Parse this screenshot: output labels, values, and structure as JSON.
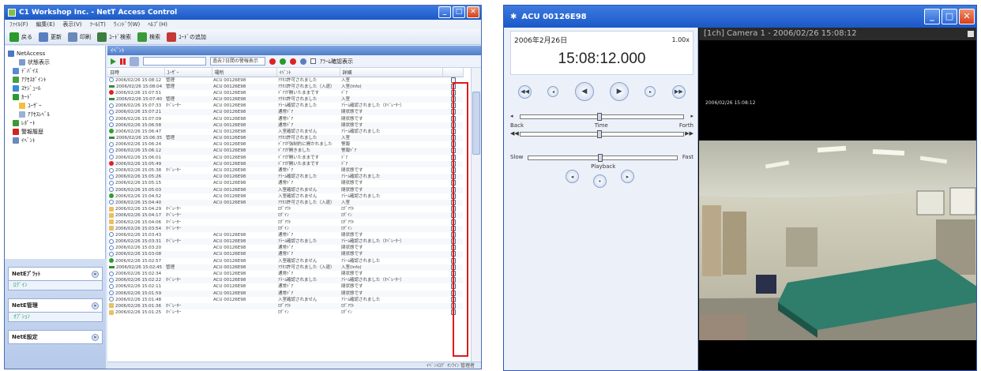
{
  "left_window": {
    "title": "C1 Workshop Inc. - NetT Access Control",
    "menu": [
      "ﾌｧｲﾙ(F)",
      "編集(E)",
      "表示(V)",
      "ﾂｰﾙ(T)",
      "ｳｨﾝﾄﾞｳ(W)",
      "ﾍﾙﾌﾟ(H)"
    ],
    "toolbar": [
      {
        "label": "戻る",
        "color": "#2c9a2c"
      },
      {
        "label": "更新",
        "color": "#5a7fc0"
      },
      {
        "label": "印刷",
        "color": "#6a8ab8"
      },
      {
        "label": "ｺｰﾄﾞ検索",
        "color": "#3f7c3f"
      },
      {
        "label": "検索",
        "color": "#3a9a3a"
      },
      {
        "label": "ｺｰﾄﾞの追加",
        "color": "#c43838"
      }
    ],
    "tree": [
      {
        "label": "NetAccess",
        "color": "#4a78c4"
      },
      {
        "label": "状態表示",
        "color": "#7c9ad0"
      },
      {
        "label": "ﾃﾞﾊﾞｲｽ",
        "color": "#5a8ad4"
      },
      {
        "label": "ｱｸｾｽﾎﾟｲﾝﾄ",
        "color": "#45a045"
      },
      {
        "label": "ｽｹｼﾞｭｰﾙ",
        "color": "#3a8ad4"
      },
      {
        "label": "ｶｰﾄﾞ",
        "color": "#2c9a2c"
      },
      {
        "label": "ﾕｰｻﾞｰ",
        "color": "#f0c040"
      },
      {
        "label": "ｱｸｾｽﾚﾍﾞﾙ",
        "color": "#9ab0d8"
      },
      {
        "label": "ﾚﾎﾟｰﾄ",
        "color": "#3a9a3a"
      },
      {
        "label": "警報履歴",
        "color": "#d22222"
      },
      {
        "label": "ｲﾍﾞﾝﾄ",
        "color": "#6a8ab8"
      }
    ],
    "panels": [
      {
        "title": "NetEﾌﾟﾗｯﾄ",
        "item": "ﾛｸﾞｲﾝ"
      },
      {
        "title": "NetE管理",
        "item": "ｵﾌﾟｼｮﾝ"
      },
      {
        "title": "NetE設定",
        "item": ""
      }
    ],
    "list_header": "ｲﾍﾞﾝﾄ",
    "filter": {
      "dropdown": "過去7日間の警報表示",
      "checkbox_label": "ｱﾗｰﾑ確認表示"
    },
    "columns": [
      "日時",
      "ﾕｰｻﾞｰ",
      "場所",
      "ｲﾍﾞﾝﾄ",
      "詳細",
      ""
    ],
    "rows": [
      [
        "info",
        "2006/02/26 15:08:12",
        "管理",
        "ACU 00126E98",
        "ｱｸｾｽ許可されました",
        "入室"
      ],
      [
        "bar",
        "2006/02/26 15:08:04",
        "管理",
        "ACU 00126E98",
        "ｱｸｾｽ許可されました（入退）",
        "入室(Info)"
      ],
      [
        "red",
        "2006/02/26 15:07:51",
        "",
        "ACU 00126E98",
        "ﾄﾞｱが開いたままです",
        "ﾄﾞｱ"
      ],
      [
        "bar",
        "2006/02/26 15:07:40",
        "管理",
        "ACU 00126E98",
        "ｱｸｾｽ許可されました",
        "入室"
      ],
      [
        "info",
        "2006/02/26 15:07:33",
        "ｵﾍﾟﾚｰﾀｰ",
        "ACU 00126E98",
        "ｱﾗｰﾑ確認されました",
        "ｱﾗｰﾑ確認されました（ｵﾍﾟﾚｰﾀｰ）"
      ],
      [
        "info",
        "2006/02/26 15:07:21",
        "",
        "ACU 00126E98",
        "通常ﾄﾞｱ",
        "閉状態です"
      ],
      [
        "info",
        "2006/02/26 15:07:09",
        "",
        "ACU 00126E98",
        "通常ﾄﾞｱ",
        "閉状態です"
      ],
      [
        "info",
        "2006/02/26 15:06:58",
        "",
        "ACU 00126E98",
        "通常ﾄﾞｱ",
        "閉状態です"
      ],
      [
        "green",
        "2006/02/26 15:06:47",
        "",
        "ACU 00126E98",
        "入室確認されません",
        "ｱﾗｰﾑ確認されました"
      ],
      [
        "bar",
        "2006/02/26 15:06:35",
        "管理",
        "ACU 00126E98",
        "ｱｸｾｽ許可されました",
        "入室"
      ],
      [
        "info",
        "2006/02/26 15:06:24",
        "",
        "ACU 00126E98",
        "ﾄﾞｱが強制的に開かれました",
        "警報"
      ],
      [
        "info",
        "2006/02/26 15:06:12",
        "",
        "ACU 00126E98",
        "ﾄﾞｱが開きました",
        "警報ﾄﾞｱ"
      ],
      [
        "info",
        "2006/02/26 15:06:01",
        "",
        "ACU 00126E98",
        "ﾄﾞｱが開いたままです",
        "ﾄﾞｱ"
      ],
      [
        "red",
        "2006/02/26 15:05:49",
        "",
        "ACU 00126E98",
        "ﾄﾞｱが開いたままです",
        "ﾄﾞｱ"
      ],
      [
        "info",
        "2006/02/26 15:05:38",
        "ｵﾍﾟﾚｰﾀｰ",
        "ACU 00126E98",
        "通常ﾄﾞｱ",
        "閉状態です"
      ],
      [
        "info",
        "2006/02/26 15:05:26",
        "",
        "ACU 00126E98",
        "ｱﾗｰﾑ確認されました",
        "ｱﾗｰﾑ確認されました"
      ],
      [
        "info",
        "2006/02/26 15:05:15",
        "",
        "ACU 00126E98",
        "通常ﾄﾞｱ",
        "閉状態です"
      ],
      [
        "info",
        "2006/02/26 15:05:03",
        "",
        "ACU 00126E98",
        "入室確認されません",
        "閉状態です"
      ],
      [
        "green",
        "2006/02/26 15:04:52",
        "",
        "ACU 00126E98",
        "入室確認されません",
        "ｱﾗｰﾑ確認されました"
      ],
      [
        "info",
        "2006/02/26 15:04:40",
        "",
        "ACU 00126E98",
        "ｱｸｾｽ許可されました（入退）",
        "入室"
      ],
      [
        "doc",
        "2006/02/26 15:04:29",
        "ｵﾍﾟﾚｰﾀｰ",
        "",
        "ﾛｸﾞｱｳﾄ",
        "ﾛｸﾞｱｳﾄ"
      ],
      [
        "doc",
        "2006/02/26 15:04:17",
        "ｵﾍﾟﾚｰﾀｰ",
        "",
        "ﾛｸﾞｲﾝ",
        "ﾛｸﾞｲﾝ"
      ],
      [
        "doc",
        "2006/02/26 15:04:06",
        "ｵﾍﾟﾚｰﾀｰ",
        "",
        "ﾛｸﾞｱｳﾄ",
        "ﾛｸﾞｱｳﾄ"
      ],
      [
        "doc",
        "2006/02/26 15:03:54",
        "ｵﾍﾟﾚｰﾀｰ",
        "",
        "ﾛｸﾞｲﾝ",
        "ﾛｸﾞｲﾝ"
      ],
      [
        "info",
        "2006/02/26 15:03:43",
        "",
        "ACU 00126E98",
        "通常ﾄﾞｱ",
        "閉状態です"
      ],
      [
        "info",
        "2006/02/26 15:03:31",
        "ｵﾍﾟﾚｰﾀｰ",
        "ACU 00126E98",
        "ｱﾗｰﾑ確認されました",
        "ｱﾗｰﾑ確認されました（ｵﾍﾟﾚｰﾀｰ）"
      ],
      [
        "info",
        "2006/02/26 15:03:20",
        "",
        "ACU 00126E98",
        "通常ﾄﾞｱ",
        "閉状態です"
      ],
      [
        "info",
        "2006/02/26 15:03:08",
        "",
        "ACU 00126E98",
        "通常ﾄﾞｱ",
        "閉状態です"
      ],
      [
        "green",
        "2006/02/26 15:02:57",
        "",
        "ACU 00126E98",
        "入室確認されません",
        "ｱﾗｰﾑ確認されました"
      ],
      [
        "bar",
        "2006/02/26 15:02:45",
        "管理",
        "ACU 00126E98",
        "ｱｸｾｽ許可されました（入退）",
        "入室(Info)"
      ],
      [
        "info",
        "2006/02/26 15:02:34",
        "",
        "ACU 00126E98",
        "通常ﾄﾞｱ",
        "閉状態です"
      ],
      [
        "info",
        "2006/02/26 15:02:22",
        "ｵﾍﾟﾚｰﾀｰ",
        "ACU 00126E98",
        "ｱﾗｰﾑ確認されました",
        "ｱﾗｰﾑ確認されました（ｵﾍﾟﾚｰﾀｰ）"
      ],
      [
        "info",
        "2006/02/26 15:02:11",
        "",
        "ACU 00126E98",
        "通常ﾄﾞｱ",
        "閉状態です"
      ],
      [
        "info",
        "2006/02/26 15:01:59",
        "",
        "ACU 00126E98",
        "通常ﾄﾞｱ",
        "閉状態です"
      ],
      [
        "info",
        "2006/02/26 15:01:48",
        "",
        "ACU 00126E98",
        "入室確認されません",
        "ｱﾗｰﾑ確認されました"
      ],
      [
        "doc",
        "2006/02/26 15:01:36",
        "ｵﾍﾟﾚｰﾀｰ",
        "",
        "ﾛｸﾞｱｳﾄ",
        "ﾛｸﾞｱｳﾄ"
      ],
      [
        "doc",
        "2006/02/26 15:01:25",
        "ｵﾍﾟﾚｰﾀｰ",
        "",
        "ﾛｸﾞｲﾝ",
        "ﾛｸﾞｲﾝ"
      ]
    ],
    "status": "ｲﾍﾞﾝﾄﾛｸﾞ  ｵﾝﾗｲﾝ  管理者",
    "highlight_color": "#e01a1a"
  },
  "right_window": {
    "title": "ACU 00126E98",
    "date": "2006年2月26日",
    "speed": "1.00x",
    "time": "15:08:12.000",
    "video_header": "[1ch] Camera 1 - 2006/02/26 15:08:12",
    "osd": "2006/02/26 15:08:12",
    "sliders": {
      "time": {
        "label": "Time",
        "left": "Back",
        "right": "Forth"
      },
      "playback": {
        "label": "Playback",
        "left": "Slow",
        "right": "Fast"
      }
    }
  }
}
